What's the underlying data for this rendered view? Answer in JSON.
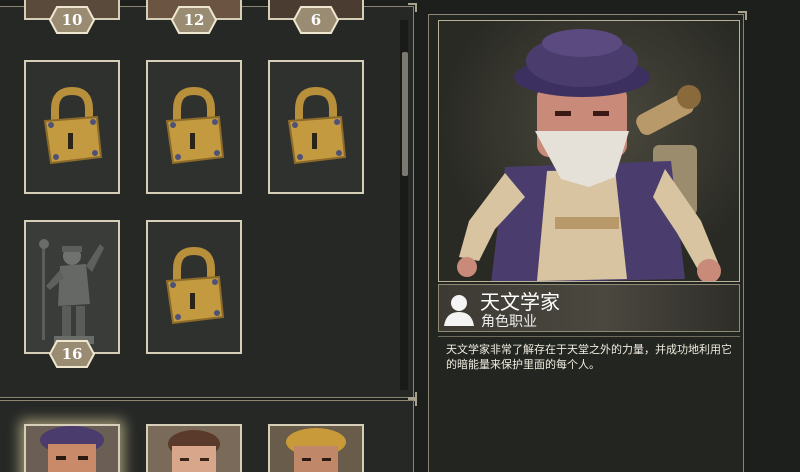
{
  "stub_cards": [
    {
      "level": "10"
    },
    {
      "level": "12"
    },
    {
      "level": "6"
    }
  ],
  "unlocked_card": {
    "level": "16"
  },
  "detail": {
    "character_name": "天文学家",
    "character_role": "角色职业",
    "description": "天文学家非常了解存在于天堂之外的力量，并成功地利用它的暗能量来保护里面的每个人。"
  },
  "colors": {
    "lock_gold": "#c49a40",
    "badge_fill": "#9a8c72",
    "card_border": "#d6cfb8",
    "hat_purple": "#4a3d6e"
  }
}
